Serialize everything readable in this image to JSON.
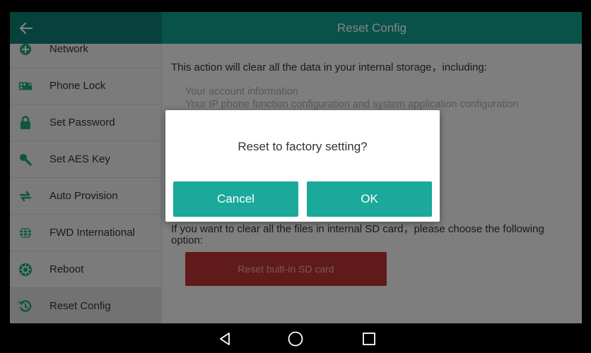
{
  "header": {
    "title": "Reset Config",
    "back_icon": "arrow-left-icon"
  },
  "colors": {
    "header": "#129e8e",
    "header_back": "#0c7f71",
    "dialog_button": "#1aa99a",
    "danger_button": "#b83232"
  },
  "sidebar": {
    "items": [
      {
        "label": "Network",
        "icon": "network-icon"
      },
      {
        "label": "Phone Lock",
        "icon": "phone-lock-icon"
      },
      {
        "label": "Set Password",
        "icon": "lock-icon"
      },
      {
        "label": "Set AES Key",
        "icon": "key-icon"
      },
      {
        "label": "Auto Provision",
        "icon": "sync-icon"
      },
      {
        "label": "FWD International",
        "icon": "globe-icon"
      },
      {
        "label": "Reboot",
        "icon": "reboot-icon"
      },
      {
        "label": "Reset Config",
        "icon": "reset-icon",
        "selected": true
      }
    ]
  },
  "main": {
    "intro": "This action will clear all the data in your internal storage，including:",
    "bullets": [
      "Your account information",
      "Your IP phone function configuration and system application configuration"
    ],
    "sd_text": "If you want to clear all the files in internal SD card，please choose the following option:",
    "sd_button": "Reset built-in SD card"
  },
  "dialog": {
    "message": "Reset to factory setting?",
    "cancel_label": "Cancel",
    "ok_label": "OK"
  },
  "navbar": {
    "buttons": [
      "back-triangle-icon",
      "home-circle-icon",
      "recents-square-icon"
    ]
  }
}
